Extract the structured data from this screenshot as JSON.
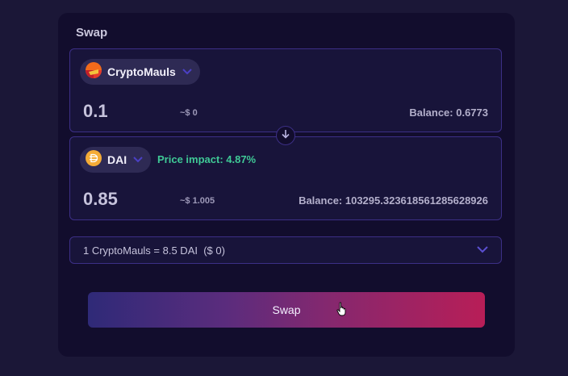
{
  "panel": {
    "title": "Swap"
  },
  "from": {
    "token": "CryptoMauls",
    "icon": "cryptomauls-token-icon",
    "amount": "0.1",
    "usd": "~$ 0",
    "balance": "Balance: 0.6773"
  },
  "to": {
    "token": "DAI",
    "icon": "dai-token-icon",
    "amount": "0.85",
    "usd": "~$ 1.005",
    "balance": "Balance: 103295.323618561285628926",
    "price_impact": "Price impact: 4.87%"
  },
  "rate": {
    "text": "1 CryptoMauls = 8.5 DAI  ($ 0)"
  },
  "swap_button": {
    "label": "Swap"
  },
  "colors": {
    "background": "#1b1737",
    "panel": "#120d2d",
    "border": "#3c2f86",
    "accent": "#5b4fd1",
    "impact_green": "#3fc996",
    "button_gradient_start": "#2f2a78",
    "button_gradient_end": "#b81e57"
  }
}
